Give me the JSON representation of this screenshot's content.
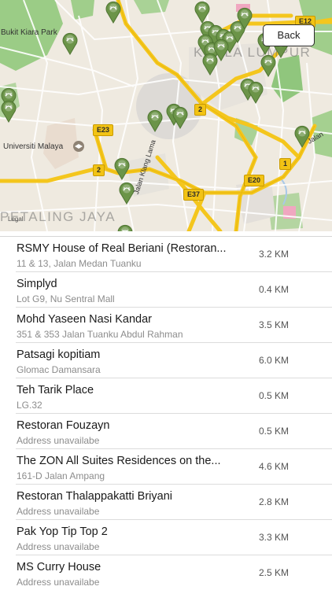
{
  "map": {
    "labels": {
      "bukit_kiara": "Bukit Kiara Park",
      "universiti_malaya": "Universiti Malaya",
      "kuala_lumpur": "KUALA LUMPUR",
      "petaling_jaya": "PETALING JAYA",
      "jalan_klang_lama": "Jalan Klang Lama",
      "jalan": "Jalan",
      "legal": "Legal"
    },
    "route_shields": {
      "e12": "E12",
      "e23": "E23",
      "e20": "E20",
      "e37": "E37",
      "r2a": "2",
      "r2b": "2",
      "r1": "1"
    },
    "back_label": "Back",
    "colors": {
      "road": "#f4c61d",
      "park": "#7fbf6b",
      "pin": "#6b9448"
    }
  },
  "restaurants": [
    {
      "name": "RSMY House of Real Beriani (Restoran...",
      "address": "11 & 13, Jalan Medan Tuanku",
      "distance": "3.2 KM"
    },
    {
      "name": "Simplyd",
      "address": "Lot G9, Nu Sentral Mall",
      "distance": "0.4 KM"
    },
    {
      "name": "Mohd Yaseen Nasi Kandar",
      "address": "351 & 353 Jalan Tuanku Abdul Rahman",
      "distance": "3.5 KM"
    },
    {
      "name": "Patsagi kopitiam",
      "address": "Glomac Damansara",
      "distance": "6.0 KM"
    },
    {
      "name": "Teh Tarik Place",
      "address": "LG.32",
      "distance": "0.5 KM"
    },
    {
      "name": "Restoran Fouzayn",
      "address": "Address unavailabe",
      "distance": "0.5 KM"
    },
    {
      "name": "The ZON All Suites Residences on the...",
      "address": "161-D Jalan Ampang",
      "distance": "4.6 KM"
    },
    {
      "name": "Restoran Thalappakatti Briyani",
      "address": "Address unavailabe",
      "distance": "2.8 KM"
    },
    {
      "name": "Pak Yop Tip Top 2",
      "address": "Address unavailabe",
      "distance": "3.3 KM"
    },
    {
      "name": "MS Curry House",
      "address": "Address unavailabe",
      "distance": "2.5 KM"
    }
  ]
}
